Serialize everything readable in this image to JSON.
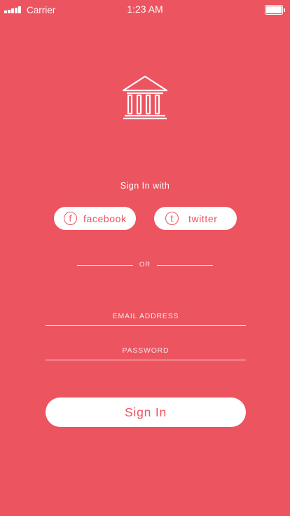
{
  "status_bar": {
    "carrier": "Carrier",
    "time": "1:23 AM"
  },
  "logo": {
    "icon": "bank-building-icon"
  },
  "social_login": {
    "heading": "Sign In with",
    "facebook": {
      "label": "facebook",
      "glyph": "f",
      "icon": "facebook-icon"
    },
    "twitter": {
      "label": "twitter",
      "glyph": "t",
      "icon": "twitter-icon"
    }
  },
  "divider": {
    "label": "OR"
  },
  "form": {
    "email_placeholder": "EMAIL ADDRESS",
    "email_value": "",
    "password_placeholder": "PASSWORD",
    "password_value": "",
    "submit_label": "Sign In"
  },
  "colors": {
    "background": "#ec5460",
    "foreground": "#ffffff"
  }
}
